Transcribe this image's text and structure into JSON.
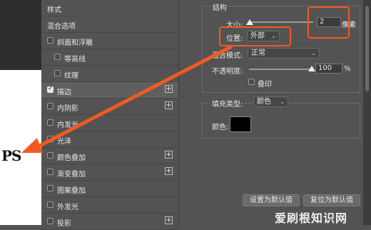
{
  "canvas": {
    "text": "PS"
  },
  "styles_panel": {
    "items": [
      {
        "label": "样式",
        "checkbox": false,
        "checked": false,
        "plus": false
      },
      {
        "label": "混合选项",
        "checkbox": false,
        "checked": false,
        "plus": false
      },
      {
        "label": "斜面和浮雕",
        "checkbox": true,
        "checked": false,
        "plus": false
      },
      {
        "label": "等高线",
        "checkbox": true,
        "checked": false,
        "plus": false
      },
      {
        "label": "纹理",
        "checkbox": true,
        "checked": false,
        "plus": false
      },
      {
        "label": "描边",
        "checkbox": true,
        "checked": true,
        "plus": true
      },
      {
        "label": "内阴影",
        "checkbox": true,
        "checked": false,
        "plus": true
      },
      {
        "label": "内发光",
        "checkbox": true,
        "checked": false,
        "plus": false
      },
      {
        "label": "光泽",
        "checkbox": true,
        "checked": false,
        "plus": false
      },
      {
        "label": "颜色叠加",
        "checkbox": true,
        "checked": false,
        "plus": true
      },
      {
        "label": "渐变叠加",
        "checkbox": true,
        "checked": false,
        "plus": true
      },
      {
        "label": "图案叠加",
        "checkbox": true,
        "checked": false,
        "plus": false
      },
      {
        "label": "外发光",
        "checkbox": true,
        "checked": false,
        "plus": false
      },
      {
        "label": "投影",
        "checkbox": true,
        "checked": false,
        "plus": true
      }
    ]
  },
  "stroke": {
    "structure_label": "结构",
    "size_label": "大小:",
    "size_value": "2",
    "size_unit": "像素",
    "position_label": "位置:",
    "position_value": "外部",
    "blend_label": "混合模式:",
    "blend_value": "正常",
    "opacity_label": "不透明度:",
    "opacity_value": "100",
    "opacity_unit": "%",
    "opacity_level": 1.0,
    "overprint_label": "叠印",
    "fill_type_label": "填充类型:",
    "fill_type_value": "颜色",
    "color_label": "颜色:",
    "color_value": "#000000"
  },
  "buttons": {
    "set_default": "设置为默认值",
    "reset_default": "复位为默认值"
  },
  "watermark": "爱刷根知识网",
  "colors": {
    "highlight": "#f05a22",
    "arrow": "#f05a22"
  }
}
